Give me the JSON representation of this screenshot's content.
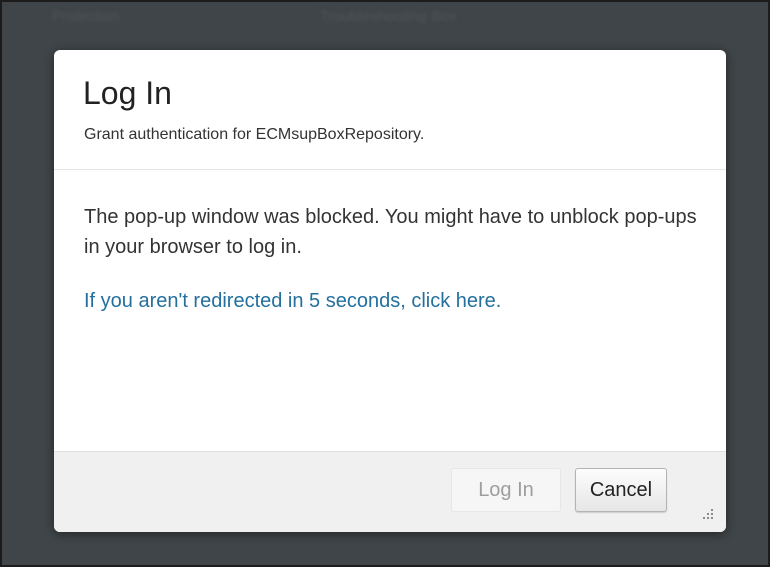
{
  "background": {
    "left_text": "Protection",
    "center_text": "Troubleshooting Box"
  },
  "dialog": {
    "title": "Log In",
    "subtitle": "Grant authentication for ECMsupBoxRepository.",
    "message": "The pop-up window was blocked. You might have to unblock pop-ups in your browser to log in.",
    "redirect_link": "If you aren't redirected in 5 seconds, click here.",
    "buttons": {
      "login_label": "Log In",
      "login_state": "disabled",
      "cancel_label": "Cancel"
    }
  },
  "colors": {
    "overlay": "#3f4548",
    "link": "#23709e",
    "footer": "#f0f0f0"
  },
  "icons": {
    "resize": "resize-grip-icon"
  }
}
